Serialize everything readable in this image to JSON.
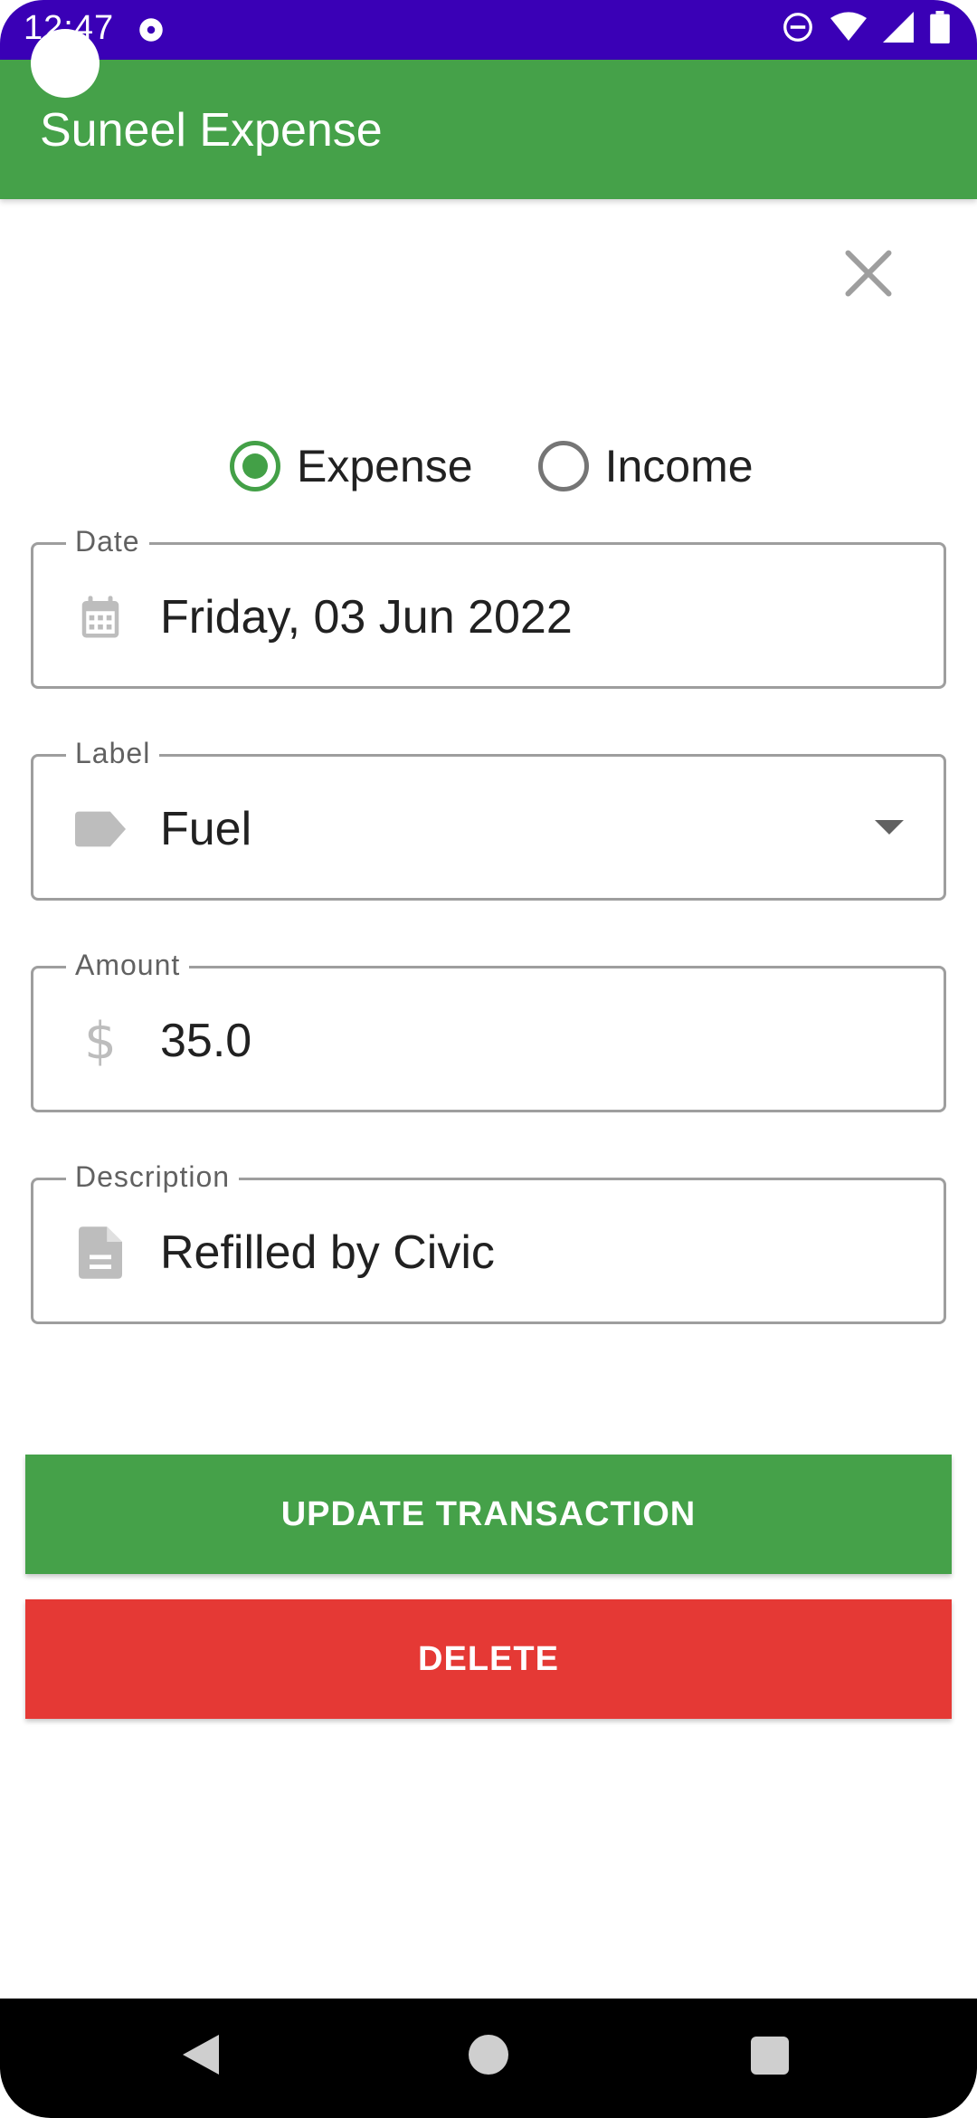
{
  "status_bar": {
    "time": "12:47",
    "icons": [
      "media-icon",
      "do-not-disturb-icon",
      "wifi-icon",
      "signal-icon",
      "battery-icon"
    ]
  },
  "app_bar": {
    "title": "Suneel Expense",
    "color": "#45a149"
  },
  "type_selector": {
    "options": [
      {
        "label": "Expense",
        "selected": true
      },
      {
        "label": "Income",
        "selected": false
      }
    ]
  },
  "fields": {
    "date": {
      "label": "Date",
      "value": "Friday, 03 Jun 2022",
      "icon": "calendar-icon"
    },
    "category": {
      "label": "Label",
      "value": "Fuel",
      "icon": "tag-icon"
    },
    "amount": {
      "label": "Amount",
      "value": "35.0",
      "icon": "dollar-icon",
      "icon_glyph": "$"
    },
    "description": {
      "label": "Description",
      "value": "Refilled by Civic",
      "icon": "document-icon"
    }
  },
  "buttons": {
    "update": {
      "label": "UPDATE TRANSACTION",
      "color": "#45a149"
    },
    "delete": {
      "label": "DELETE",
      "color": "#e53935"
    }
  },
  "nav_bar": {
    "icons": [
      "back-icon",
      "home-icon",
      "recents-icon"
    ]
  }
}
